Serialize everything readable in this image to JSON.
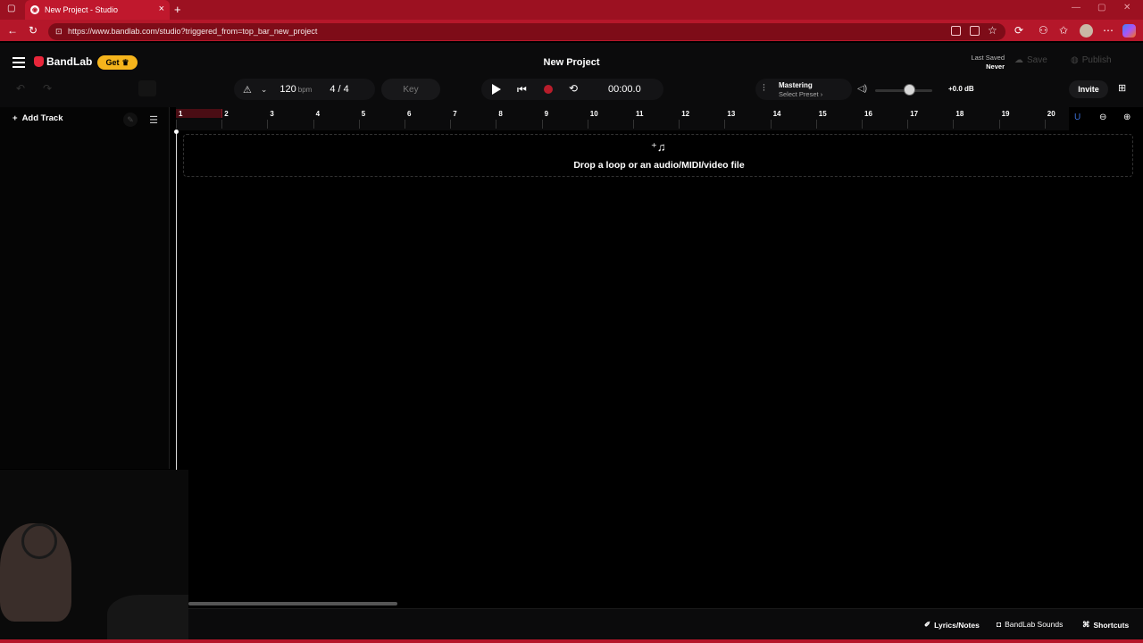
{
  "browser": {
    "tab_title": "New Project - Studio",
    "url": "https://www.bandlab.com/studio?triggered_from=top_bar_new_project"
  },
  "header": {
    "brand": "BandLab",
    "get_label": "Get",
    "project_title": "New Project",
    "last_saved_label": "Last Saved",
    "last_saved_value": "Never",
    "save_label": "Save",
    "publish_label": "Publish",
    "invite_label": "Invite"
  },
  "toolbar": {
    "bpm_value": "120",
    "bpm_unit": "bpm",
    "time_signature": "4 / 4",
    "key_label": "Key",
    "time_display": "00:00.0",
    "mastering_label": "Mastering",
    "mastering_preset": "Select Preset",
    "volume_db": "+0.0 dB",
    "volume_level": 0.6
  },
  "tracks_panel": {
    "add_track_label": "Add Track"
  },
  "ruler": {
    "bars": [
      "1",
      "2",
      "3",
      "4",
      "5",
      "6",
      "7",
      "8",
      "9",
      "10",
      "11",
      "12",
      "13",
      "14",
      "15",
      "16",
      "17",
      "18",
      "19",
      "20"
    ]
  },
  "dropzone": {
    "text": "Drop a loop or an audio/MIDI/video file"
  },
  "bottombar": {
    "lyrics_label": "Lyrics/Notes",
    "sounds_label": "BandLab Sounds",
    "shortcuts_label": "Shortcuts"
  },
  "colors": {
    "browser_accent": "#b5172a",
    "record": "#b81d2b",
    "get_button": "#f5b41c"
  }
}
